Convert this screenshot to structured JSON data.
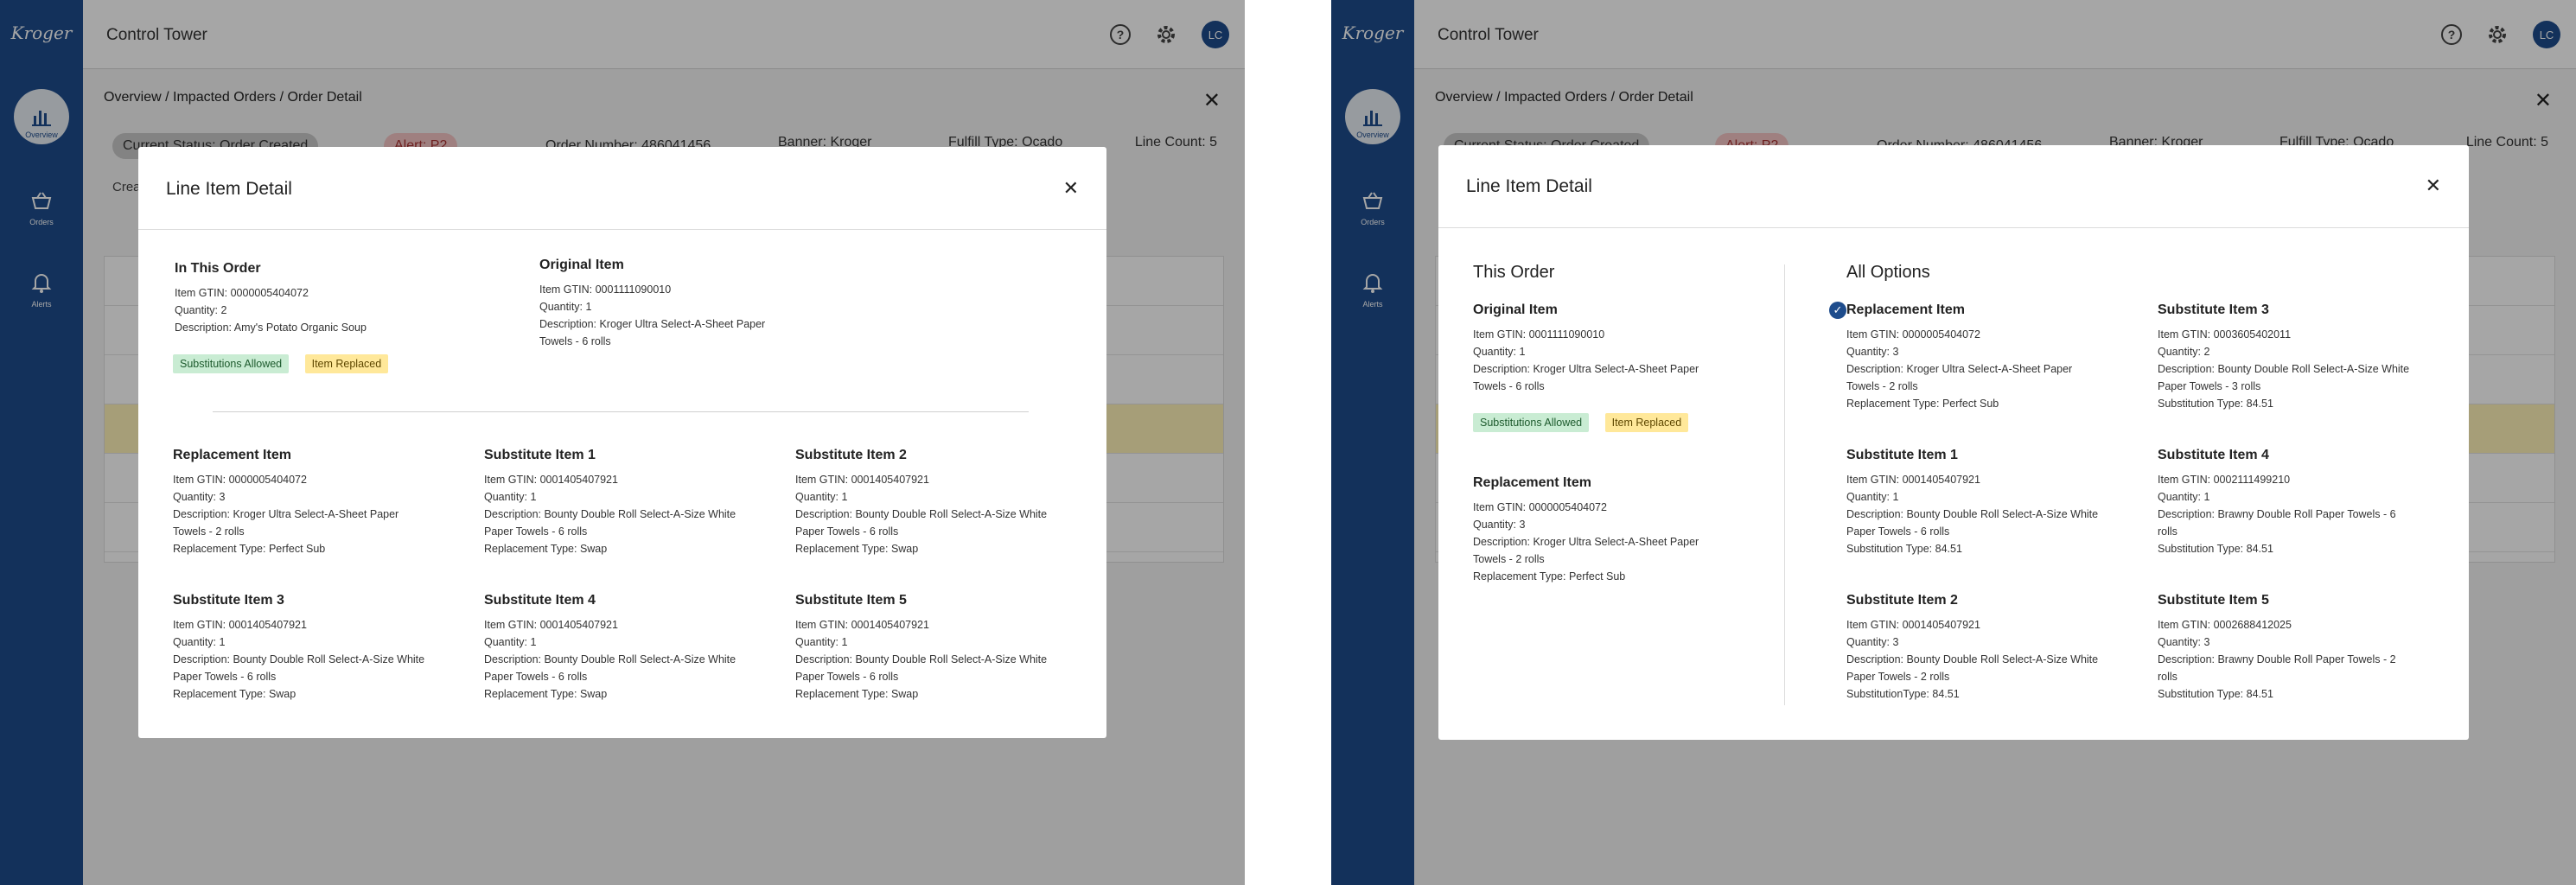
{
  "app": {
    "logo": "Kroger",
    "title": "Control Tower",
    "avatar_initials": "LC",
    "nav": {
      "overview": "Overview",
      "orders": "Orders",
      "alerts": "Alerts"
    }
  },
  "page": {
    "breadcrumb": "Overview / Impacted Orders / Order Detail",
    "status": "Current Status: Order Created",
    "alert": "Alert: P2",
    "order_number": "Order Number: 486041456",
    "banner": "Banner: Kroger",
    "fulfill_type": "Fulfill Type: Ocado",
    "line_count": "Line Count: 5",
    "created": "Crea"
  },
  "left_modal": {
    "title": "Line Item Detail",
    "in_this_order": {
      "title": "In This Order",
      "gtin": "Item GTIN: 0000005404072",
      "quantity": "Quantity: 2",
      "description": "Description: Amy's Potato Organic Soup"
    },
    "original_item": {
      "title": "Original Item",
      "gtin": "Item GTIN: 0001111090010",
      "quantity": "Quantity: 1",
      "description_1": "Description: Kroger Ultra Select-A-Sheet Paper",
      "description_2": "Towels - 6 rolls"
    },
    "badges": {
      "substitutions": "Substitutions Allowed",
      "replaced": "Item Replaced"
    },
    "items": [
      {
        "title": "Replacement Item",
        "gtin": "Item GTIN: 0000005404072",
        "quantity": "Quantity: 3",
        "desc1": "Description: Kroger Ultra Select-A-Sheet Paper",
        "desc2": "Towels - 2 rolls",
        "type": "Replacement Type: Perfect Sub"
      },
      {
        "title": "Substitute Item 1",
        "gtin": "Item GTIN: 0001405407921",
        "quantity": "Quantity: 1",
        "desc1": "Description: Bounty Double Roll Select-A-Size White",
        "desc2": "Paper Towels - 6 rolls",
        "type": "Replacement Type: Swap"
      },
      {
        "title": "Substitute Item 2",
        "gtin": "Item GTIN: 0001405407921",
        "quantity": "Quantity: 1",
        "desc1": "Description: Bounty Double Roll Select-A-Size White",
        "desc2": "Paper Towels - 6 rolls",
        "type": "Replacement Type: Swap"
      },
      {
        "title": "Substitute Item 3",
        "gtin": "Item GTIN: 0001405407921",
        "quantity": "Quantity: 1",
        "desc1": "Description: Bounty Double Roll Select-A-Size White",
        "desc2": "Paper Towels - 6 rolls",
        "type": "Replacement Type: Swap"
      },
      {
        "title": "Substitute Item 4",
        "gtin": "Item GTIN: 0001405407921",
        "quantity": "Quantity: 1",
        "desc1": "Description: Bounty Double Roll Select-A-Size White",
        "desc2": "Paper Towels - 6 rolls",
        "type": "Replacement Type: Swap"
      },
      {
        "title": "Substitute Item 5",
        "gtin": "Item GTIN: 0001405407921",
        "quantity": "Quantity: 1",
        "desc1": "Description: Bounty Double Roll Select-A-Size White",
        "desc2": "Paper Towels - 6 rolls",
        "type": "Replacement Type: Swap"
      }
    ]
  },
  "right_modal": {
    "title": "Line Item Detail",
    "this_order_heading": "This Order",
    "all_options_heading": "All Options",
    "original_item": {
      "title": "Original Item",
      "gtin": "Item GTIN: 0001111090010",
      "quantity": "Quantity: 1",
      "desc1": "Description: Kroger Ultra Select-A-Sheet Paper",
      "desc2": "Towels - 6 rolls"
    },
    "badges": {
      "substitutions": "Substitutions Allowed",
      "replaced": "Item Replaced"
    },
    "replacement_item": {
      "title": "Replacement Item",
      "gtin": "Item GTIN: 0000005404072",
      "quantity": "Quantity: 3",
      "desc1": "Description: Kroger Ultra Select-A-Sheet Paper",
      "desc2": "Towels - 2 rolls",
      "type": "Replacement Type: Perfect Sub"
    },
    "options": [
      {
        "title": "Replacement Item",
        "gtin": "Item GTIN: 0000005404072",
        "quantity": "Quantity: 3",
        "desc1": "Description: Kroger Ultra Select-A-Sheet Paper",
        "desc2": "Towels - 2 rolls",
        "type": "Replacement Type: Perfect Sub",
        "selected": true
      },
      {
        "title": "Substitute Item 3",
        "gtin": "Item GTIN: 0003605402011",
        "quantity": "Quantity: 2",
        "desc1": "Description: Bounty Double Roll Select-A-Size White",
        "desc2": "Paper Towels - 3 rolls",
        "type": "Substitution Type: 84.51"
      },
      {
        "title": "Substitute Item 1",
        "gtin": "Item GTIN: 0001405407921",
        "quantity": "Quantity: 1",
        "desc1": "Description: Bounty Double Roll Select-A-Size White",
        "desc2": "Paper Towels - 6 rolls",
        "type": "Substitution Type: 84.51"
      },
      {
        "title": "Substitute Item 4",
        "gtin": "Item GTIN: 0002111499210",
        "quantity": "Quantity: 1",
        "desc1": "Description: Brawny Double Roll Paper Towels - 6",
        "desc2": "rolls",
        "type": "Substitution Type: 84.51"
      },
      {
        "title": "Substitute Item 2",
        "gtin": "Item GTIN: 0001405407921",
        "quantity": "Quantity: 3",
        "desc1": "Description: Bounty Double Roll Select-A-Size White",
        "desc2": "Paper Towels - 2 rolls",
        "type": "SubstitutionType: 84.51"
      },
      {
        "title": "Substitute Item 5",
        "gtin": "Item GTIN: 0002688412025",
        "quantity": "Quantity: 3",
        "desc1": "Description: Brawny Double Roll Paper Towels - 2",
        "desc2": "rolls",
        "type": "Substitution Type: 84.51"
      }
    ]
  }
}
